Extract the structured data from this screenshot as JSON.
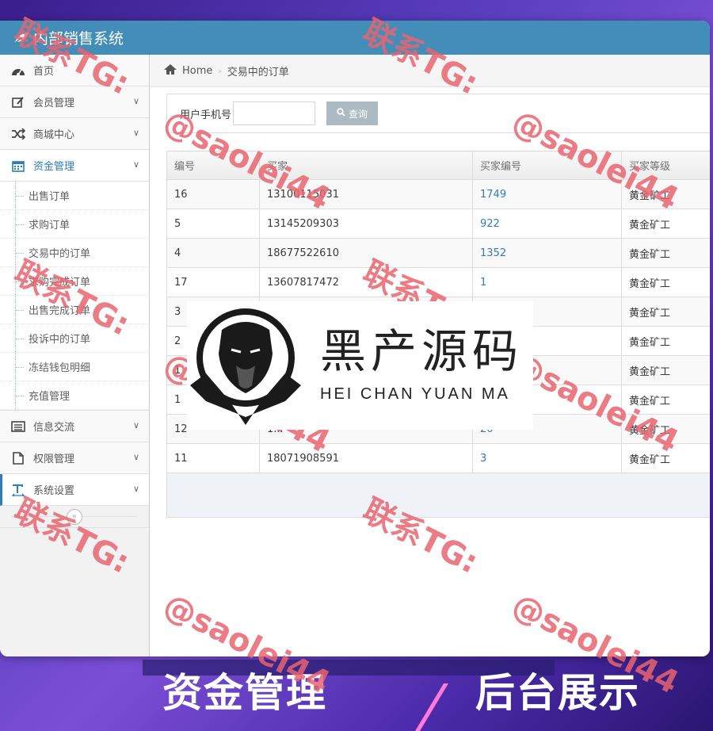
{
  "app": {
    "title": "内部销售系统"
  },
  "sidebar": {
    "items": [
      {
        "label": "首页",
        "icon": "dashboard-icon",
        "has_children": false
      },
      {
        "label": "会员管理",
        "icon": "edit-icon",
        "has_children": true
      },
      {
        "label": "商城中心",
        "icon": "shuffle-icon",
        "has_children": true
      },
      {
        "label": "资金管理",
        "icon": "calendar-icon",
        "has_children": true,
        "open": true,
        "children": [
          "出售订单",
          "求购订单",
          "交易中的订单",
          "求购完成订单",
          "出售完成订单",
          "投诉中的订单",
          "冻结钱包明细",
          "充值管理"
        ]
      },
      {
        "label": "信息交流",
        "icon": "list-alt-icon",
        "has_children": true
      },
      {
        "label": "权限管理",
        "icon": "file-icon",
        "has_children": true
      },
      {
        "label": "系统设置",
        "icon": "text-width-icon",
        "has_children": true
      }
    ]
  },
  "breadcrumb": {
    "home": "Home",
    "current": "交易中的订单"
  },
  "search": {
    "label": "用户手机号",
    "value": "",
    "placeholder": "",
    "button": "查询"
  },
  "table": {
    "headers": [
      "编号",
      "买家",
      "买家编号",
      "买家等级"
    ],
    "rows": [
      [
        "16",
        "13100115031",
        "1749",
        "黄金矿工"
      ],
      [
        "5",
        "13145209303",
        "922",
        "黄金矿工"
      ],
      [
        "4",
        "18677522610",
        "1352",
        "黄金矿工"
      ],
      [
        "17",
        "13607817472",
        "1",
        "黄金矿工"
      ],
      [
        "3",
        "",
        "",
        "黄金矿工"
      ],
      [
        "2",
        "",
        "",
        "黄金矿工"
      ],
      [
        "1",
        "",
        "",
        "黄金矿工"
      ],
      [
        "1",
        "",
        "",
        "黄金矿工"
      ],
      [
        "12",
        "1...",
        "20",
        "黄金矿工"
      ],
      [
        "11",
        "18071908591",
        "3",
        "黄金矿工"
      ]
    ]
  },
  "watermark": {
    "tg": "联系TG:",
    "handle": "@saolei44"
  },
  "logo": {
    "cn": "黑产源码",
    "en": "HEI CHAN YUAN MA"
  },
  "footer": {
    "left": "资金管理",
    "right": "后台展示"
  },
  "colors": {
    "navbar": "#438eb9",
    "accent": "#2b7dbc",
    "link": "#337ab7",
    "watermark": "#e8646e"
  }
}
